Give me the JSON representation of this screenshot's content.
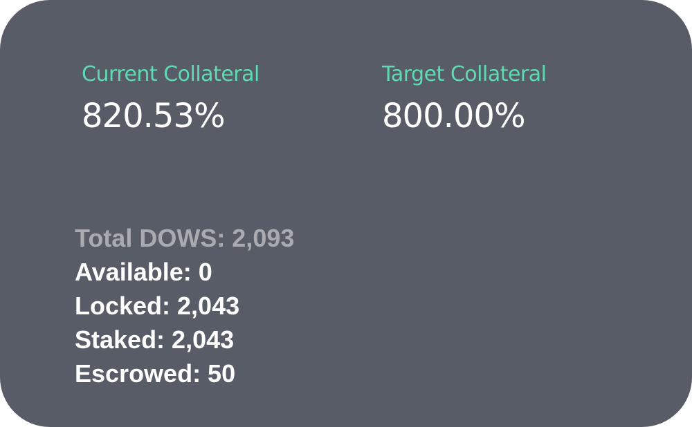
{
  "colors": {
    "card_background": "#585c66",
    "accent_label": "#5fdbb2",
    "value_text": "#ffffff",
    "muted_text": "#a9abb1"
  },
  "collateral": {
    "current_label": "Current Collateral",
    "current_value": "820.53%",
    "target_label": "Target Collateral",
    "target_value": "800.00%"
  },
  "balances": {
    "total": "Total DOWS: 2,093",
    "available": "Available: 0",
    "locked": "Locked: 2,043",
    "staked": "Staked: 2,043",
    "escrowed": "Escrowed: 50"
  }
}
